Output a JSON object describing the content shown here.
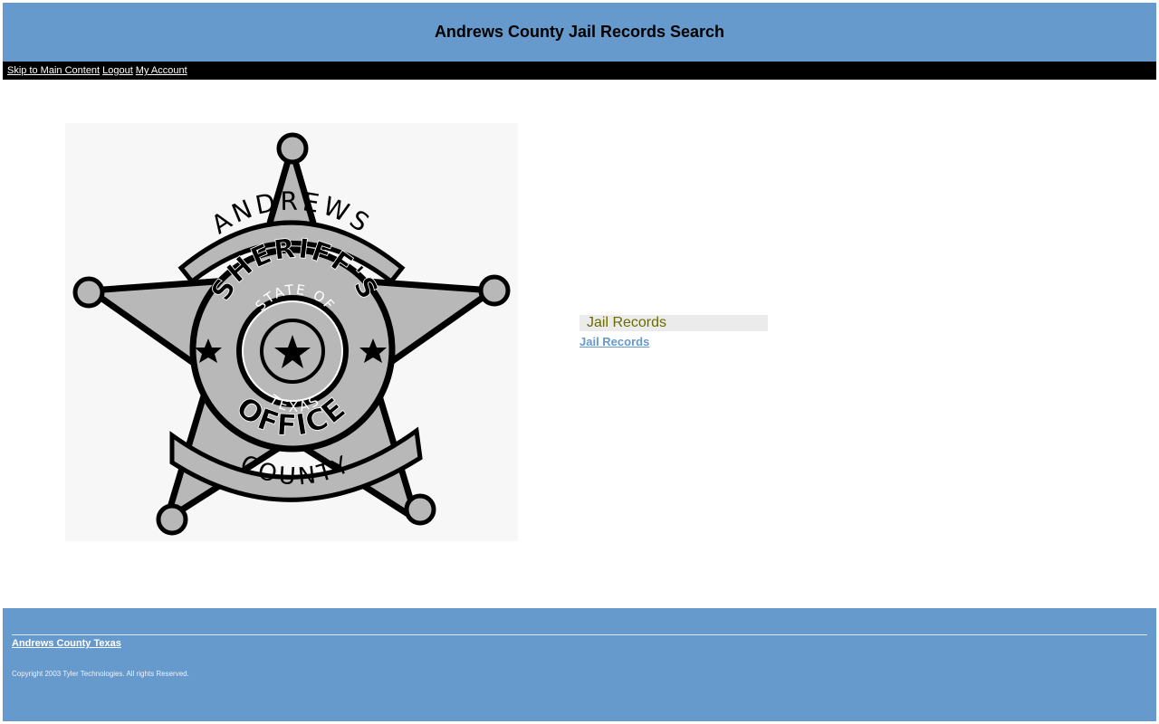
{
  "header": {
    "title": "Andrews County Jail Records Search"
  },
  "nav": {
    "skip_label": "Skip to Main Content",
    "logout_label": "Logout",
    "account_label": "My Account"
  },
  "logo": {
    "alt": "Andrews County Sheriff's Office badge",
    "text_top": "ANDREWS",
    "text_sheriffs": "SHERIFF'S",
    "text_state_of": "STATE OF",
    "text_texas": "TEXAS",
    "text_office": "OFFICE",
    "text_county": "COUNTY"
  },
  "jail_panel": {
    "heading": "Jail Records",
    "link_label": "Jail Records"
  },
  "footer": {
    "county_link": "Andrews County Texas",
    "copyright": "Copyright 2003 Tyler Technologies. All rights Reserved."
  },
  "colors": {
    "header_bg": "#6699cc",
    "nav_bg": "#000000",
    "panel_heading_bg": "#ebebeb",
    "panel_heading_text": "#6b6b00",
    "link": "#6699cc"
  }
}
